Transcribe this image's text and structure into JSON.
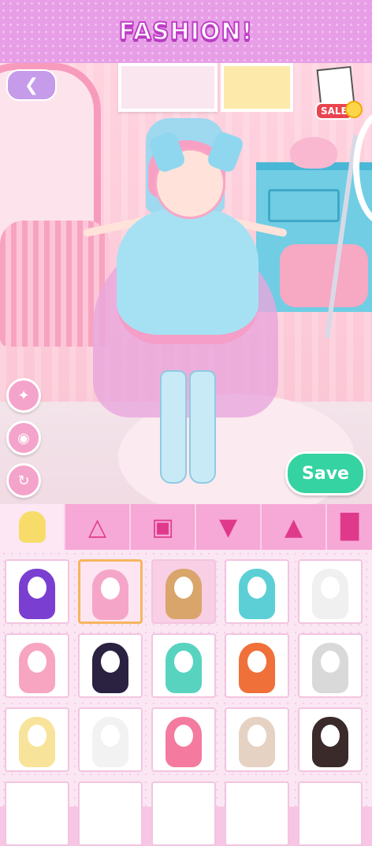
{
  "header": {
    "title": "FASHION!"
  },
  "nav": {
    "back_icon": "chevron-left-icon"
  },
  "shop": {
    "sale_label": "SALE"
  },
  "actions": {
    "save_label": "Save"
  },
  "colors": {
    "accent_pink": "#f6a8d6",
    "save_green": "#34d3a1",
    "header_purple": "#e79ee6"
  },
  "tabs": [
    {
      "name": "hair",
      "icon": "hair-icon",
      "active": true
    },
    {
      "name": "dress",
      "icon": "dress-icon",
      "active": false
    },
    {
      "name": "jacket",
      "icon": "jacket-icon",
      "active": false
    },
    {
      "name": "top",
      "icon": "top-icon",
      "active": false
    },
    {
      "name": "skirt",
      "icon": "skirt-icon",
      "active": false
    },
    {
      "name": "socks",
      "icon": "socks-icon",
      "active": false
    }
  ],
  "items": [
    {
      "color": "#7a3fd1",
      "selected": false
    },
    {
      "color": "#f5a6c8",
      "selected": true
    },
    {
      "color": "#d9a56b",
      "selected": false
    },
    {
      "color": "#5ccfd6",
      "selected": false
    },
    {
      "color": "#f0f0f0",
      "selected": false
    },
    {
      "color": "#f7a5c0",
      "selected": false
    },
    {
      "color": "#2b2242",
      "selected": false
    },
    {
      "color": "#58d3c0",
      "selected": false
    },
    {
      "color": "#f0703a",
      "selected": false
    },
    {
      "color": "#d9d9d9",
      "selected": false
    },
    {
      "color": "#f8e39a",
      "selected": false
    },
    {
      "color": "#f2f2f2",
      "selected": false
    },
    {
      "color": "#f47aa0",
      "selected": false
    },
    {
      "color": "#e6d2c3",
      "selected": false
    },
    {
      "color": "#3a2a2a",
      "selected": false
    }
  ]
}
